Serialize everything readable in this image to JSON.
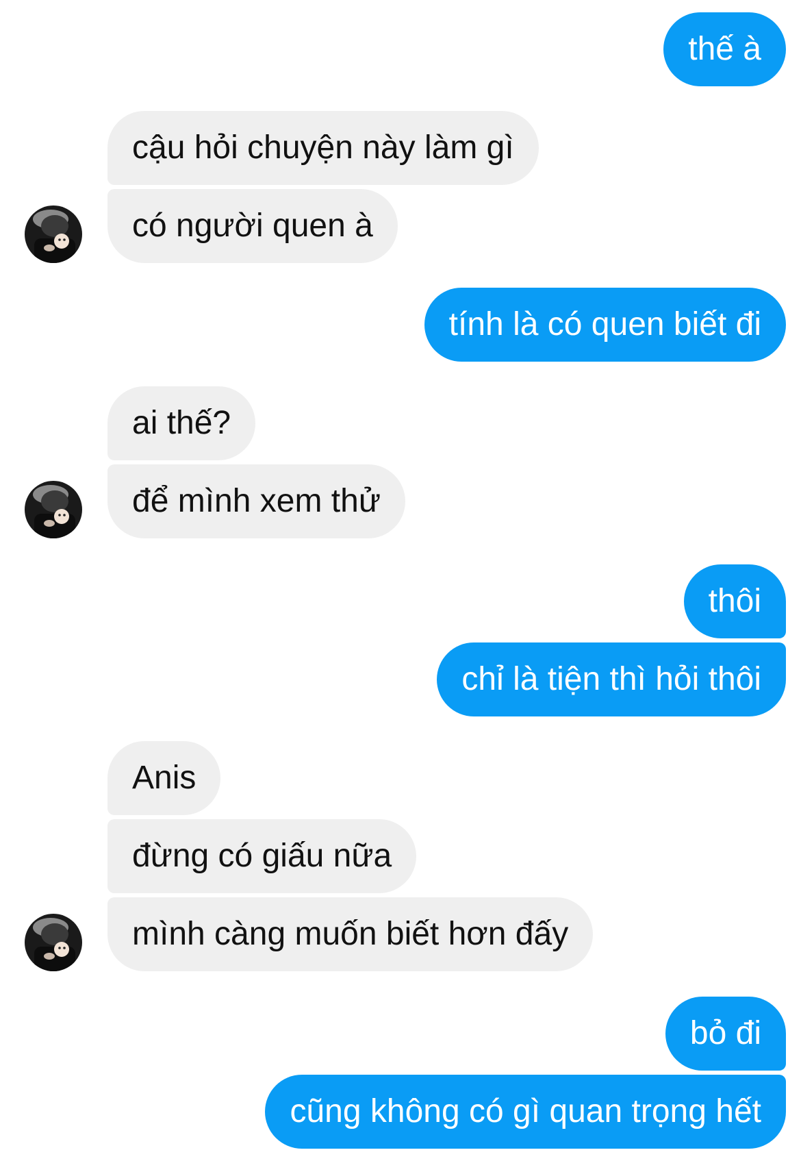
{
  "messages": [
    {
      "side": "out",
      "text": "thế à"
    },
    {
      "side": "in",
      "text": "cậu hỏi chuyện này làm gì"
    },
    {
      "side": "in",
      "text": "có người quen à"
    },
    {
      "side": "out",
      "text": "tính là có quen biết đi"
    },
    {
      "side": "in",
      "text": "ai thế?"
    },
    {
      "side": "in",
      "text": "để mình xem thử"
    },
    {
      "side": "out",
      "text": "thôi"
    },
    {
      "side": "out",
      "text": "chỉ là tiện thì hỏi thôi"
    },
    {
      "side": "in",
      "text": "Anis"
    },
    {
      "side": "in",
      "text": "đừng có giấu nữa"
    },
    {
      "side": "in",
      "text": "mình càng muốn biết hơn đấy"
    },
    {
      "side": "out",
      "text": "bỏ đi"
    },
    {
      "side": "out",
      "text": "cũng không có gì quan trọng hết"
    }
  ],
  "colors": {
    "outgoing_bubble": "#0a9cf5",
    "incoming_bubble": "#efefef",
    "outgoing_text": "#ffffff",
    "incoming_text": "#111111"
  }
}
